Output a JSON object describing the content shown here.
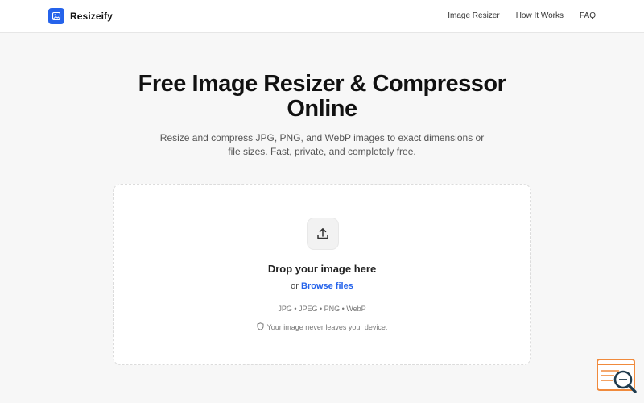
{
  "header": {
    "brand": "Resizeify",
    "nav": [
      {
        "label": "Image Resizer"
      },
      {
        "label": "How It Works"
      },
      {
        "label": "FAQ"
      }
    ]
  },
  "hero": {
    "title": "Free Image Resizer & Compressor Online",
    "subtitle": "Resize and compress JPG, PNG, and WebP images to exact dimensions or file sizes. Fast, private, and completely free."
  },
  "dropzone": {
    "icon": "upload-icon",
    "title": "Drop your image here",
    "or_text": "or",
    "browse_label": "Browse files",
    "formats": "JPG • JPEG • PNG • WebP",
    "privacy_icon": "shield-icon",
    "privacy": "Your image never leaves your device."
  },
  "colors": {
    "accent": "#2563eb",
    "widget": "#f08a3c"
  }
}
